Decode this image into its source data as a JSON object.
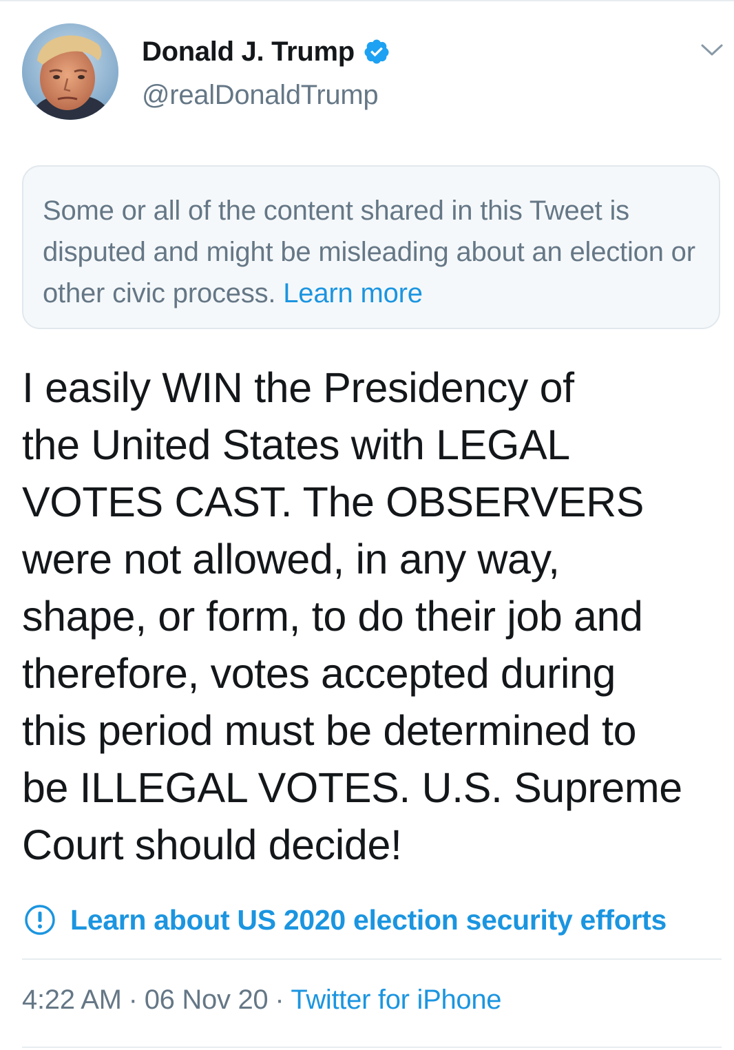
{
  "tweet": {
    "author": {
      "display_name": "Donald J. Trump",
      "handle": "@realDonaldTrump",
      "avatar_icon": "profile-photo",
      "verified_icon": "verified-badge-icon"
    },
    "menu_icon": "chevron-down-icon",
    "notice": {
      "text": "Some or all of the content shared in this Tweet is disputed and might be misleading about an election or other civic process. ",
      "link_label": "Learn more"
    },
    "body_lines": [
      "I easily WIN the Presidency of",
      "the United States with LEGAL",
      "VOTES CAST. The OBSERVERS",
      "were not allowed, in any way,",
      "shape, or form, to do their job and",
      "therefore, votes accepted during",
      "this period must be determined to",
      "be ILLEGAL VOTES. U.S. Supreme",
      "Court should decide!"
    ],
    "election_notice": {
      "icon": "info-icon",
      "label": "Learn about US 2020 election security efforts"
    },
    "meta": {
      "time": "4:22 AM",
      "separator": "·",
      "date": "06 Nov 20",
      "source": "Twitter for iPhone"
    }
  },
  "colors": {
    "link": "#1b95e0",
    "secondary_text": "#657786",
    "primary_text": "#14171a",
    "notice_background": "#f5f8fa",
    "divider": "#e6ecf0"
  }
}
